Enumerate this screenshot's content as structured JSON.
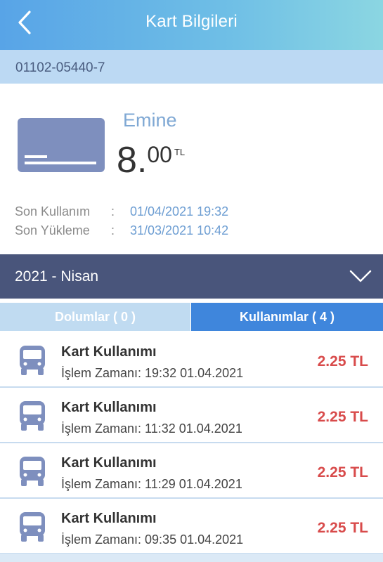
{
  "header": {
    "title": "Kart Bilgileri",
    "back_icon": "chevron-left-icon"
  },
  "card": {
    "number": "01102-05440-7",
    "owner": "Emine",
    "balance_int": "8.",
    "balance_dec": "00",
    "currency": "TL",
    "last_use_label": "Son Kullanım",
    "last_use_value": "01/04/2021 19:32",
    "last_load_label": "Son Yükleme",
    "last_load_value": "31/03/2021 10:42",
    "separator": ":"
  },
  "period": {
    "label": "2021 - Nisan",
    "icon": "chevron-down-icon"
  },
  "tabs": [
    {
      "label": "Dolumlar ( 0 )",
      "active": false
    },
    {
      "label": "Kullanımlar ( 4 )",
      "active": true
    }
  ],
  "transactions": [
    {
      "title": "Kart Kullanımı",
      "time": "İşlem Zamanı: 19:32 01.04.2021",
      "amount": "2.25 TL"
    },
    {
      "title": "Kart Kullanımı",
      "time": "İşlem Zamanı: 11:32 01.04.2021",
      "amount": "2.25 TL"
    },
    {
      "title": "Kart Kullanımı",
      "time": "İşlem Zamanı: 11:29 01.04.2021",
      "amount": "2.25 TL"
    },
    {
      "title": "Kart Kullanımı",
      "time": "İşlem Zamanı: 09:35 01.04.2021",
      "amount": "2.25 TL"
    }
  ],
  "colors": {
    "header": "#58a4e7",
    "month_bar": "#49557b",
    "active_tab": "#3f86dc",
    "amount": "#d84b4b"
  }
}
